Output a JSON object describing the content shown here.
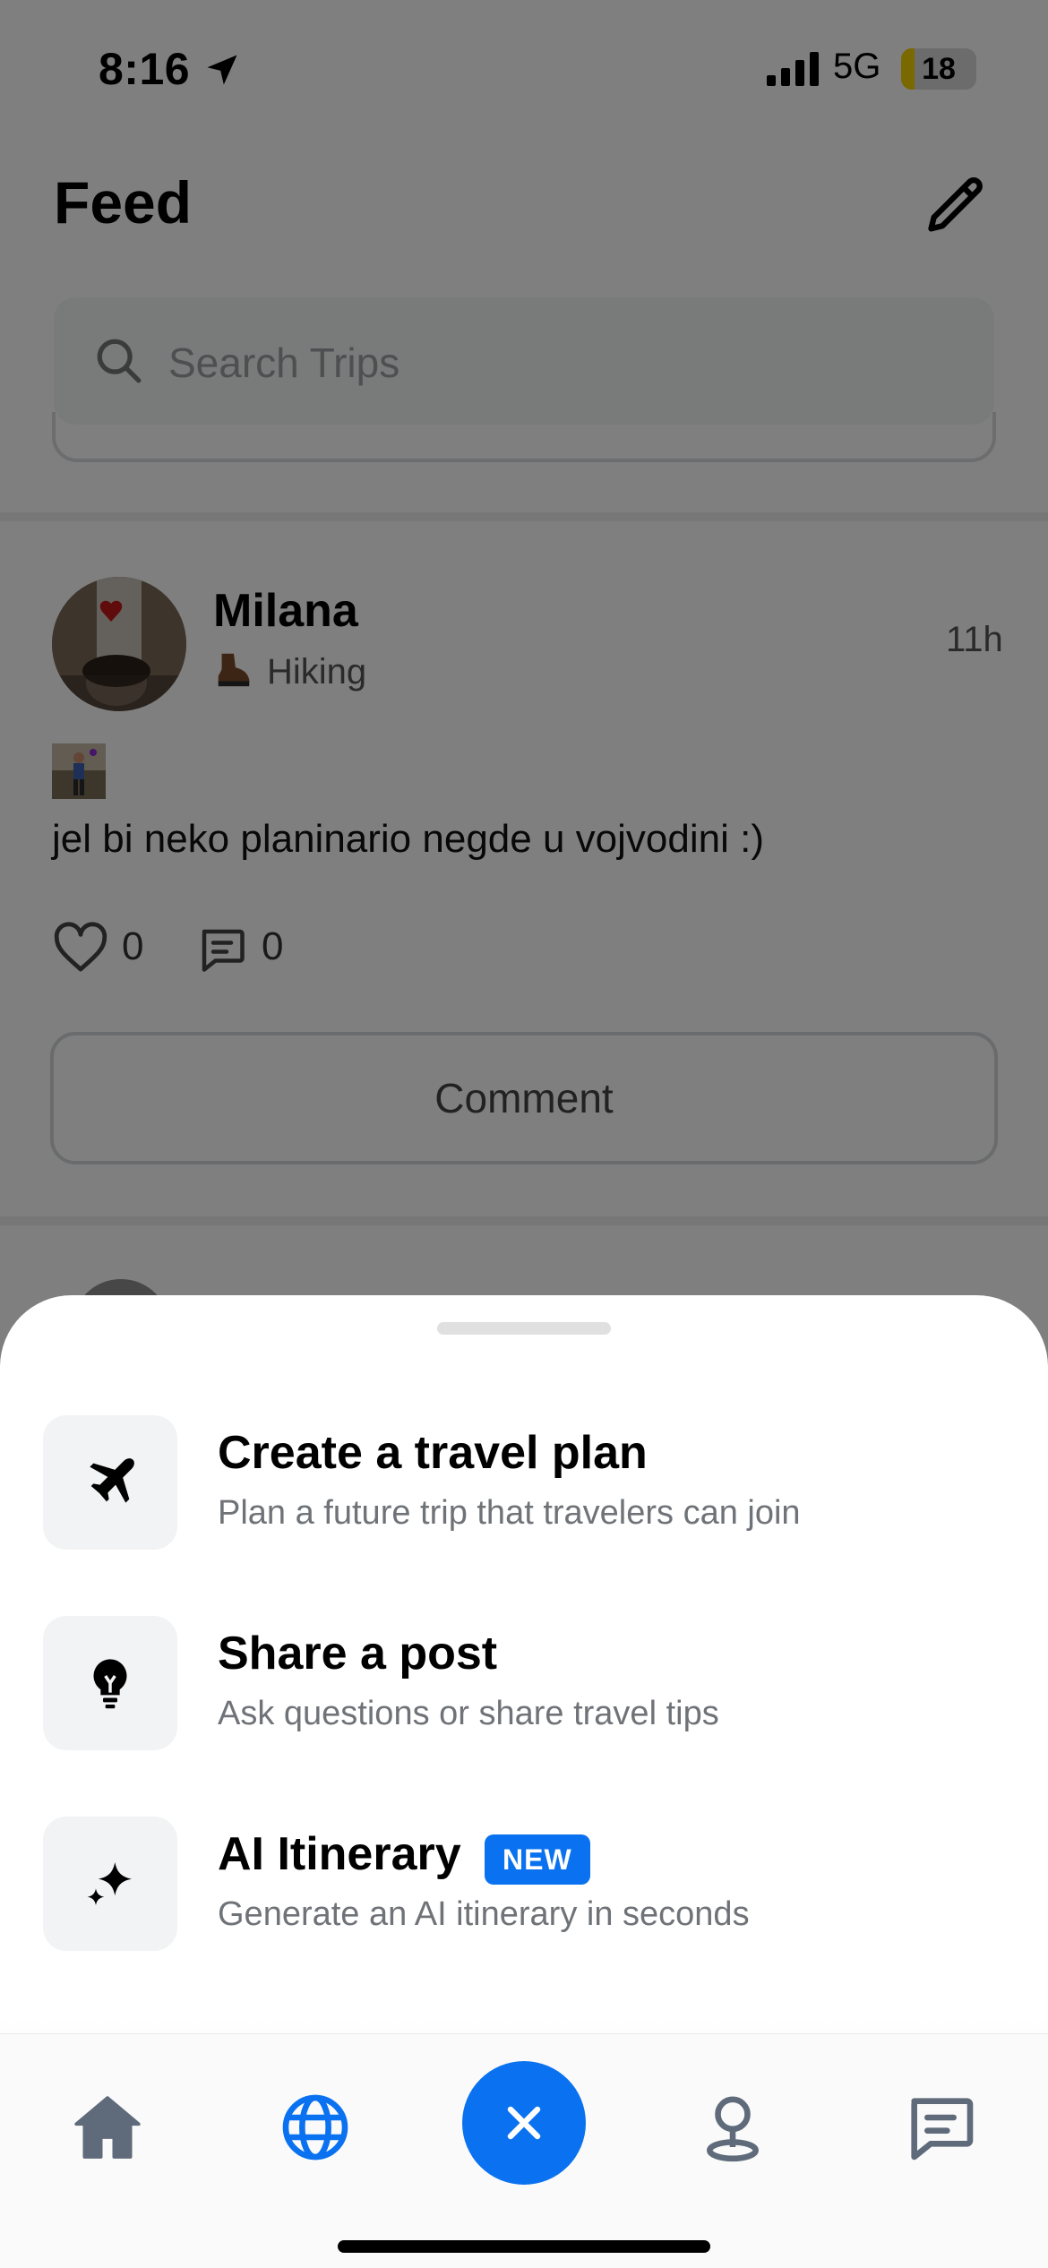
{
  "status_bar": {
    "time": "8:16",
    "network": "5G",
    "battery_level": "18",
    "battery_fraction": 0.18
  },
  "header": {
    "title": "Feed"
  },
  "search": {
    "placeholder": "Search Trips"
  },
  "post": {
    "author": "Milana",
    "activity": "Hiking",
    "time": "11h",
    "text": "jel bi neko planinario negde u vojvodini :)",
    "likes": "0",
    "comments": "0",
    "comment_button_label": "Comment"
  },
  "sheet": {
    "options": [
      {
        "title": "Create a travel plan",
        "subtitle": "Plan a future trip that travelers can join",
        "icon": "airplane-icon"
      },
      {
        "title": "Share a post",
        "subtitle": "Ask questions or share travel tips",
        "icon": "lightbulb-icon"
      },
      {
        "title": "AI Itinerary",
        "subtitle": "Generate an AI itinerary in seconds",
        "icon": "sparkles-icon",
        "badge": "NEW"
      }
    ]
  },
  "tab_bar": {
    "items": [
      {
        "icon": "home-icon",
        "active": false
      },
      {
        "icon": "globe-icon",
        "active": true
      },
      {
        "icon": "close-icon",
        "active": false
      },
      {
        "icon": "map-pin-icon",
        "active": false
      },
      {
        "icon": "chat-icon",
        "active": false
      }
    ]
  },
  "colors": {
    "accent": "#0a72f0",
    "tab_inactive": "#5f6b7a",
    "scrim": "rgba(0,0,0,0.5)"
  }
}
